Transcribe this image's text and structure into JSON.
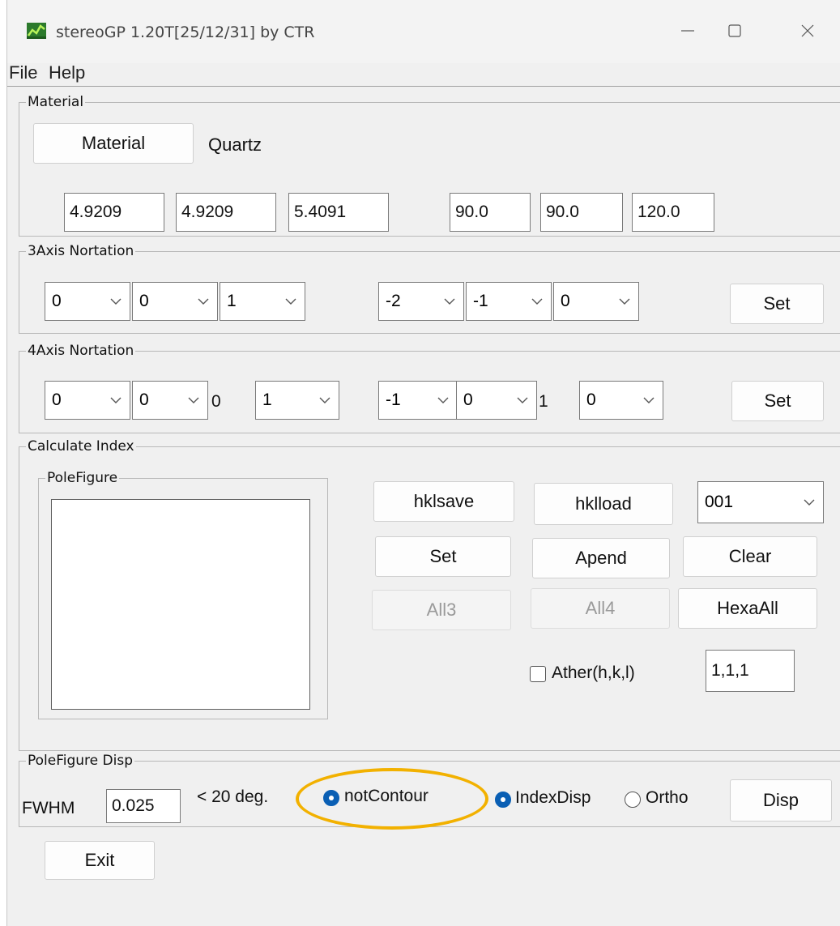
{
  "window": {
    "title": "stereoGP 1.20T[25/12/31] by CTR",
    "icon": "app-icon"
  },
  "menu": [
    "File",
    "Help"
  ],
  "material": {
    "group_label": "Material",
    "button_label": "Material",
    "name": "Quartz",
    "lattice": [
      "4.9209",
      "4.9209",
      "5.4091",
      "90.0",
      "90.0",
      "120.0"
    ]
  },
  "axis3": {
    "group_label": "3Axis Nortation",
    "selects": [
      "0",
      "0",
      "1",
      "-2",
      "-1",
      "0"
    ],
    "set_label": "Set"
  },
  "axis4": {
    "group_label": "4Axis Nortation",
    "selects": [
      "0",
      "0",
      "1",
      "-1",
      "0",
      "0"
    ],
    "static_values": [
      "0",
      "1"
    ],
    "set_label": "Set"
  },
  "calc": {
    "group_label": "Calculate Index",
    "polefigure_label": "PoleFigure",
    "hklsave": "hklsave",
    "hklload": "hklload",
    "index_select": "001",
    "set": "Set",
    "apend": "Apend",
    "clear": "Clear",
    "all3": "All3",
    "all4": "All4",
    "hexaall": "HexaAll",
    "ather_label": "Ather(h,k,l)",
    "ather_checked": false,
    "ather_value": "1,1,1"
  },
  "disp": {
    "group_label": "PoleFigure Disp",
    "fwhm_label": "FWHM",
    "fwhm_value": "0.025",
    "deg_label": "< 20 deg.",
    "not_contour": "notContour",
    "not_contour_selected": true,
    "index_disp": "IndexDisp",
    "index_disp_selected": true,
    "ortho": "Ortho",
    "ortho_selected": false,
    "disp_button": "Disp"
  },
  "exit_label": "Exit",
  "colors": {
    "accent": "#0a5fb4",
    "highlight": "#f2b100",
    "window_bg": "#f0f0f0"
  }
}
